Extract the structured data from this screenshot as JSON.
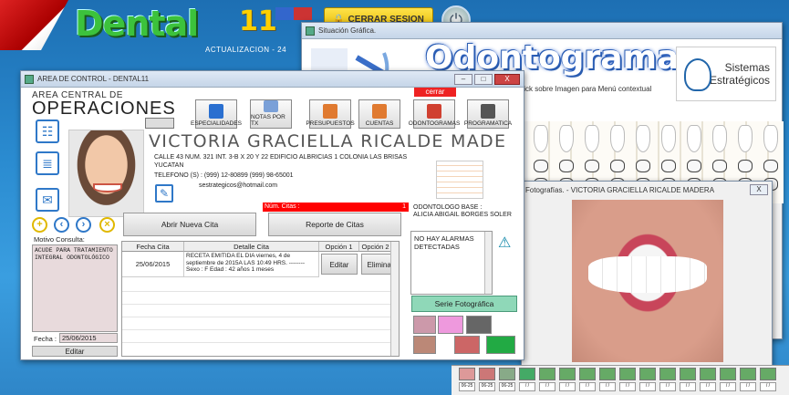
{
  "desktop": {
    "logo_text": "Dental",
    "logo_number": "11",
    "update_text": "ACTUALIZACION - 24",
    "logout_label": "CERRAR SESION"
  },
  "odontograma_window": {
    "title": "Situación Gráfica.",
    "heading": "Odontogramas",
    "hint": "bleClick sobre Imagen para Menú contextual",
    "brand_line1": "Sistemas",
    "brand_line2": "Estratégicos"
  },
  "foto_window": {
    "title": "Fotografías. - VICTORIA GRACIELLA RICALDE MADERA",
    "close": "X",
    "thumb_labels": [
      "06-25",
      "06-25",
      "06-25",
      "/  /",
      "/  /",
      "/  /",
      "/  /",
      "/  /",
      "/  /",
      "/  /",
      "/  /",
      "/  /",
      "/  /",
      "/  /",
      "/  /",
      "/  /"
    ]
  },
  "control_window": {
    "title": "AREA DE CONTROL - DENTAL11",
    "close_label": "X",
    "area_small": "AREA CENTRAL DE",
    "area_big": "OPERACIONES",
    "close_red": "cerrar",
    "toolbar": [
      {
        "label": "ESPECIALIDADES",
        "color": "#2a6fd0"
      },
      {
        "label": "NOTAS POR TX",
        "color": "#7aa0d8"
      },
      {
        "label": "PRESUPUESTOS",
        "color": "#e07a30"
      },
      {
        "label": "CUENTAS",
        "color": "#e07a30"
      },
      {
        "label": "ODONTOGRAMAS",
        "color": "#d04030"
      },
      {
        "label": "PROGRAMATICA",
        "color": "#555555"
      }
    ],
    "patient": {
      "name": "VICTORIA GRACIELLA RICALDE MADE",
      "address": "CALLE 43 NUM. 321 INT. 3-B X 20 Y 22 EDIFICIO ALBRICIAS 1 COLONIA LAS BRISAS YUCATAN",
      "phone": "TELEFONO (S) :     (999) 12-80899     (999) 98-65001",
      "email": "sestrategicos@hotmail.com"
    },
    "num_citas_label": "Núm. Citas :",
    "num_citas_value": "1",
    "buttons": {
      "new_appointment": "Abrir Nueva Cita",
      "report": "Reporte de Citas",
      "edit": "Editar"
    },
    "motivo_label": "Motivo Consulta:",
    "motivo_text": "ACUDE PARA TRATAMIENTO INTEGRAL ODONTOLÓGICO",
    "fecha_label": "Fecha :",
    "fecha_value": "25/06/2015",
    "grid": {
      "headers": [
        "Fecha Cita",
        "Detalle Cita",
        "Opción 1",
        "Opción 2"
      ],
      "rows": [
        {
          "fecha": "25/06/2015",
          "detalle": "RECETA EMITIDA EL DIA viernes, 4 de septiembre de 2015A LAS 10:49   HRS. -------- Sexo : F Edad : 42 años 1 meses",
          "opt1": "Editar",
          "opt2": "Eliminar"
        }
      ]
    },
    "odontologo_label": "ODONTOLOGO BASE :",
    "odontologo_name": "ALICIA ABIGAIL BORGES SOLER",
    "alarm_text": "NO HAY ALARMAS DETECTADAS",
    "serie_btn": "Serie Fotográfica"
  }
}
